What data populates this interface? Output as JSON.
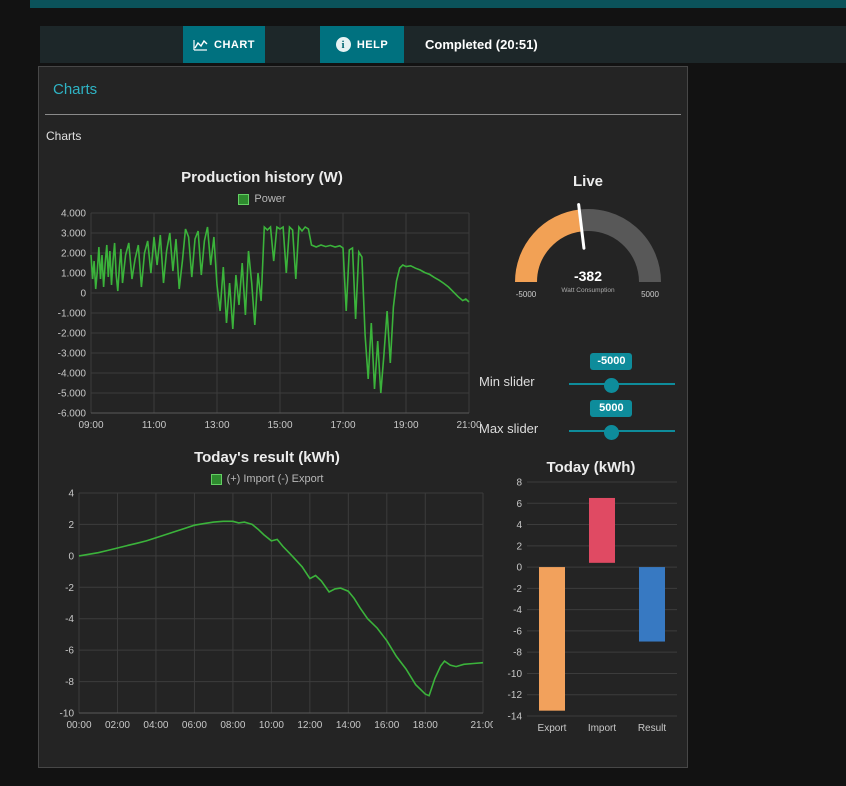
{
  "topbar": {
    "chart_label": "CHART",
    "help_label": "HELP",
    "status": "Completed (20:51)"
  },
  "panel": {
    "title": "Charts",
    "subtitle": "Charts"
  },
  "colors": {
    "accent_teal": "#00717f",
    "heading_teal": "#2fb3c4",
    "line_green": "#3bb33b",
    "gauge_orange": "#f2a155",
    "gauge_gray": "#585858",
    "bar_orange": "#f2a15c",
    "bar_red": "#e04a63",
    "bar_blue": "#3779c2",
    "slider_teal": "#0e8c9b",
    "grid": "#3c3c3c",
    "tick_text": "#c8c8c8"
  },
  "gauge": {
    "title": "Live",
    "value": -382,
    "display_value": "-382",
    "min": -5000,
    "max": 5000,
    "min_label": "-5000",
    "max_label": "5000",
    "sublabel": "Watt Consumption"
  },
  "sliders": [
    {
      "label": "Min slider",
      "value": "-5000",
      "position": 0.4
    },
    {
      "label": "Max slider",
      "value": "5000",
      "position": 0.4
    }
  ],
  "chart_data": [
    {
      "type": "line",
      "title": "Production history (W)",
      "legend": "Power",
      "xlim": [
        9,
        21
      ],
      "ylim": [
        -6000,
        4000
      ],
      "x_ticks": [
        {
          "value": 9,
          "label": "09:00"
        },
        {
          "value": 11,
          "label": "11:00"
        },
        {
          "value": 13,
          "label": "13:00"
        },
        {
          "value": 15,
          "label": "15:00"
        },
        {
          "value": 17,
          "label": "17:00"
        },
        {
          "value": 19,
          "label": "19:00"
        },
        {
          "value": 21,
          "label": "21:00"
        }
      ],
      "y_ticks": [
        {
          "value": 4000,
          "label": "4.000"
        },
        {
          "value": 3000,
          "label": "3.000"
        },
        {
          "value": 2000,
          "label": "2.000"
        },
        {
          "value": 1000,
          "label": "1.000"
        },
        {
          "value": 0,
          "label": "0"
        },
        {
          "value": -1000,
          "label": "-1.000"
        },
        {
          "value": -2000,
          "label": "-2.000"
        },
        {
          "value": -3000,
          "label": "-3.000"
        },
        {
          "value": -4000,
          "label": "-4.000"
        },
        {
          "value": -5000,
          "label": "-5.000"
        },
        {
          "value": -6000,
          "label": "-6.000"
        }
      ],
      "points": [
        [
          9,
          1900
        ],
        [
          9.05,
          700
        ],
        [
          9.1,
          1600
        ],
        [
          9.15,
          200
        ],
        [
          9.2,
          1100
        ],
        [
          9.25,
          2300
        ],
        [
          9.3,
          700
        ],
        [
          9.35,
          1900
        ],
        [
          9.4,
          300
        ],
        [
          9.45,
          1500
        ],
        [
          9.5,
          2400
        ],
        [
          9.55,
          800
        ],
        [
          9.6,
          2100
        ],
        [
          9.65,
          400
        ],
        [
          9.7,
          1600
        ],
        [
          9.75,
          2500
        ],
        [
          9.8,
          900
        ],
        [
          9.85,
          100
        ],
        [
          9.9,
          1300
        ],
        [
          9.95,
          2200
        ],
        [
          10,
          500
        ],
        [
          10.1,
          1900
        ],
        [
          10.2,
          2500
        ],
        [
          10.3,
          700
        ],
        [
          10.4,
          1700
        ],
        [
          10.5,
          2400
        ],
        [
          10.6,
          300
        ],
        [
          10.7,
          2000
        ],
        [
          10.8,
          2600
        ],
        [
          10.9,
          1000
        ],
        [
          11,
          2800
        ],
        [
          11.1,
          1400
        ],
        [
          11.2,
          2900
        ],
        [
          11.3,
          500
        ],
        [
          11.4,
          2100
        ],
        [
          11.5,
          3000
        ],
        [
          11.6,
          1100
        ],
        [
          11.7,
          2700
        ],
        [
          11.8,
          200
        ],
        [
          11.9,
          1600
        ],
        [
          12,
          3200
        ],
        [
          12.1,
          2800
        ],
        [
          12.2,
          800
        ],
        [
          12.3,
          2700
        ],
        [
          12.4,
          3100
        ],
        [
          12.5,
          900
        ],
        [
          12.6,
          2600
        ],
        [
          12.7,
          3300
        ],
        [
          12.8,
          1400
        ],
        [
          12.9,
          2800
        ],
        [
          13,
          400
        ],
        [
          13.1,
          -900
        ],
        [
          13.2,
          1300
        ],
        [
          13.3,
          -1500
        ],
        [
          13.4,
          500
        ],
        [
          13.5,
          -1800
        ],
        [
          13.6,
          900
        ],
        [
          13.7,
          -600
        ],
        [
          13.8,
          1500
        ],
        [
          13.9,
          -1100
        ],
        [
          14,
          2100
        ],
        [
          14.1,
          500
        ],
        [
          14.2,
          -1600
        ],
        [
          14.3,
          1000
        ],
        [
          14.4,
          -400
        ],
        [
          14.5,
          3300
        ],
        [
          14.6,
          3150
        ],
        [
          14.7,
          3300
        ],
        [
          14.8,
          1600
        ],
        [
          14.9,
          3300
        ],
        [
          15,
          3200
        ],
        [
          15.1,
          3300
        ],
        [
          15.2,
          1000
        ],
        [
          15.3,
          3300
        ],
        [
          15.4,
          3150
        ],
        [
          15.5,
          700
        ],
        [
          15.6,
          3300
        ],
        [
          15.7,
          3100
        ],
        [
          15.8,
          3300
        ],
        [
          15.9,
          3200
        ],
        [
          16,
          2400
        ],
        [
          16.15,
          2300
        ],
        [
          16.3,
          2400
        ],
        [
          16.45,
          2320
        ],
        [
          16.6,
          2380
        ],
        [
          16.75,
          2300
        ],
        [
          16.9,
          2360
        ],
        [
          17,
          2250
        ],
        [
          17.1,
          -900
        ],
        [
          17.2,
          2150
        ],
        [
          17.3,
          2250
        ],
        [
          17.4,
          -1300
        ],
        [
          17.5,
          2050
        ],
        [
          17.6,
          1800
        ],
        [
          17.7,
          -2100
        ],
        [
          17.8,
          -4300
        ],
        [
          17.9,
          -1500
        ],
        [
          18,
          -4800
        ],
        [
          18.1,
          -2400
        ],
        [
          18.2,
          -5000
        ],
        [
          18.3,
          -3100
        ],
        [
          18.4,
          -900
        ],
        [
          18.5,
          -3500
        ],
        [
          18.6,
          -700
        ],
        [
          18.7,
          600
        ],
        [
          18.8,
          1250
        ],
        [
          18.9,
          1400
        ],
        [
          19,
          1320
        ],
        [
          19.15,
          1360
        ],
        [
          19.3,
          1240
        ],
        [
          19.45,
          1150
        ],
        [
          19.6,
          1020
        ],
        [
          19.75,
          930
        ],
        [
          19.9,
          780
        ],
        [
          20.05,
          640
        ],
        [
          20.2,
          480
        ],
        [
          20.35,
          300
        ],
        [
          20.5,
          60
        ],
        [
          20.65,
          -180
        ],
        [
          20.8,
          -380
        ],
        [
          20.9,
          -300
        ],
        [
          21,
          -450
        ]
      ]
    },
    {
      "type": "line",
      "title": "Today's result (kWh)",
      "legend": "(+) Import (-) Export",
      "xlim": [
        0,
        21
      ],
      "ylim": [
        -10,
        4
      ],
      "x_ticks": [
        {
          "value": 0,
          "label": "00:00"
        },
        {
          "value": 2,
          "label": "02:00"
        },
        {
          "value": 4,
          "label": "04:00"
        },
        {
          "value": 6,
          "label": "06:00"
        },
        {
          "value": 8,
          "label": "08:00"
        },
        {
          "value": 10,
          "label": "10:00"
        },
        {
          "value": 12,
          "label": "12:00"
        },
        {
          "value": 14,
          "label": "14:00"
        },
        {
          "value": 16,
          "label": "16:00"
        },
        {
          "value": 18,
          "label": "18:00"
        },
        {
          "value": 21,
          "label": "21:00"
        }
      ],
      "y_ticks": [
        {
          "value": 4,
          "label": "4"
        },
        {
          "value": 2,
          "label": "2"
        },
        {
          "value": 0,
          "label": "0"
        },
        {
          "value": -2,
          "label": "-2"
        },
        {
          "value": -4,
          "label": "-4"
        },
        {
          "value": -6,
          "label": "-6"
        },
        {
          "value": -8,
          "label": "-8"
        },
        {
          "value": -10,
          "label": "-10"
        }
      ],
      "points": [
        [
          0,
          0
        ],
        [
          0.5,
          0.1
        ],
        [
          1,
          0.2
        ],
        [
          1.5,
          0.35
        ],
        [
          2,
          0.5
        ],
        [
          2.5,
          0.65
        ],
        [
          3,
          0.8
        ],
        [
          3.5,
          0.95
        ],
        [
          4,
          1.15
        ],
        [
          4.5,
          1.35
        ],
        [
          5,
          1.55
        ],
        [
          5.5,
          1.75
        ],
        [
          6,
          1.95
        ],
        [
          6.5,
          2.05
        ],
        [
          7,
          2.15
        ],
        [
          7.5,
          2.2
        ],
        [
          8,
          2.2
        ],
        [
          8.3,
          2.1
        ],
        [
          8.6,
          2.15
        ],
        [
          9,
          2.0
        ],
        [
          9.3,
          1.7
        ],
        [
          9.6,
          1.35
        ],
        [
          10,
          0.95
        ],
        [
          10.3,
          1.05
        ],
        [
          10.6,
          0.6
        ],
        [
          11,
          0.1
        ],
        [
          11.3,
          -0.3
        ],
        [
          11.6,
          -0.7
        ],
        [
          12,
          -1.45
        ],
        [
          12.3,
          -1.25
        ],
        [
          12.6,
          -1.6
        ],
        [
          13,
          -2.3
        ],
        [
          13.3,
          -2.1
        ],
        [
          13.6,
          -2.05
        ],
        [
          14,
          -2.25
        ],
        [
          14.3,
          -2.7
        ],
        [
          14.6,
          -3.3
        ],
        [
          15,
          -4.0
        ],
        [
          15.5,
          -4.6
        ],
        [
          16,
          -5.4
        ],
        [
          16.5,
          -6.4
        ],
        [
          17,
          -7.2
        ],
        [
          17.5,
          -8.2
        ],
        [
          18,
          -8.8
        ],
        [
          18.2,
          -8.9
        ],
        [
          18.5,
          -7.8
        ],
        [
          18.8,
          -7.0
        ],
        [
          19,
          -6.7
        ],
        [
          19.3,
          -6.95
        ],
        [
          19.6,
          -7.05
        ],
        [
          20,
          -6.9
        ],
        [
          20.5,
          -6.85
        ],
        [
          21,
          -6.8
        ]
      ]
    },
    {
      "type": "bar",
      "title": "Today (kWh)",
      "categories": [
        "Export",
        "Import",
        "Result"
      ],
      "ylim": [
        -14,
        8
      ],
      "y_ticks": [
        {
          "value": 8,
          "label": "8"
        },
        {
          "value": 6,
          "label": "6"
        },
        {
          "value": 4,
          "label": "4"
        },
        {
          "value": 2,
          "label": "2"
        },
        {
          "value": 0,
          "label": "0"
        },
        {
          "value": -2,
          "label": "-2"
        },
        {
          "value": -4,
          "label": "-4"
        },
        {
          "value": -6,
          "label": "-6"
        },
        {
          "value": -8,
          "label": "-8"
        },
        {
          "value": -10,
          "label": "-10"
        },
        {
          "value": -12,
          "label": "-12"
        },
        {
          "value": -14,
          "label": "-14"
        }
      ],
      "bars": [
        {
          "label": "Export",
          "from": 0,
          "to": -13.5,
          "color": "#f2a15c"
        },
        {
          "label": "Import",
          "from": 0.4,
          "to": 6.5,
          "color": "#e04a63"
        },
        {
          "label": "Result",
          "from": 0,
          "to": -7,
          "color": "#3779c2"
        }
      ]
    }
  ]
}
